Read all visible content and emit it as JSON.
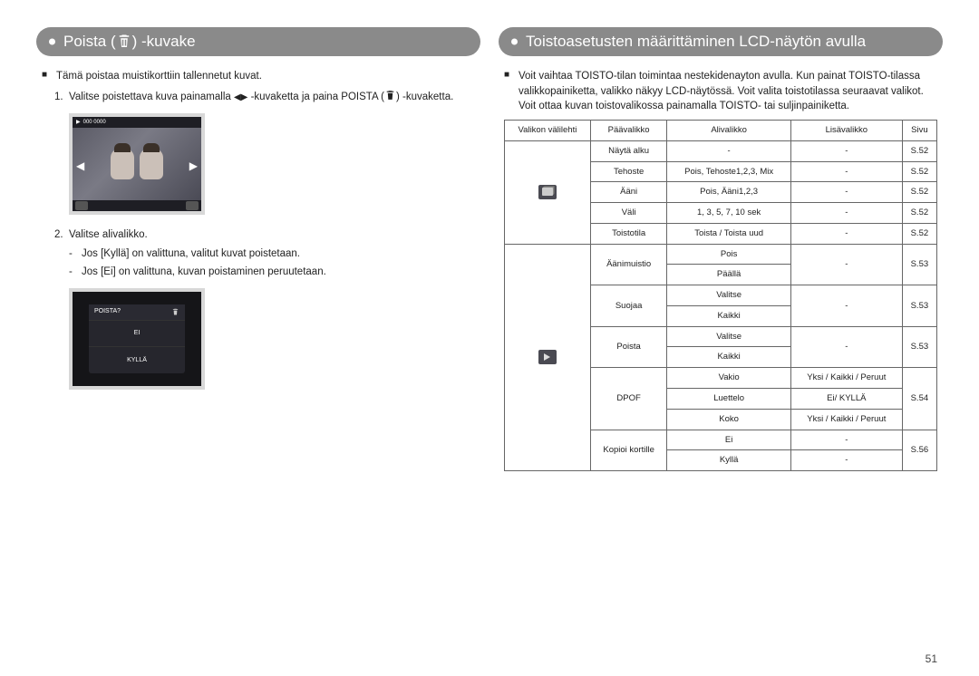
{
  "left": {
    "header_prefix": "Poista (",
    "header_suffix": ") -kuvake",
    "intro": "Tämä poistaa muistikorttiin tallennetut kuvat.",
    "step1a": "Valitse poistettava kuva painamalla ",
    "step1b": " -kuvaketta ja paina POISTA (",
    "step1c": ") -kuvaketta.",
    "cam1_top": "000 0000",
    "step2": "Valitse alivalikko.",
    "dash1": "Jos [Kyllä] on valittuna, valitut kuvat poistetaan.",
    "dash2": "Jos [Ei] on valittuna, kuvan poistaminen peruutetaan.",
    "cam2_title": "POISTA?",
    "cam2_opt1": "EI",
    "cam2_opt2": "KYLLÄ"
  },
  "right": {
    "header": "Toistoasetusten määrittäminen LCD-näytön avulla",
    "intro": "Voit vaihtaa TOISTO-tilan toimintaa nestekidenayton avulla. Kun painat TOISTO-tilassa valikkopainiketta, valikko näkyy LCD-näytössä. Voit valita toistotilassa seuraavat valikot. Voit ottaa kuvan toistovalikossa painamalla TOISTO- tai suljinpainiketta.",
    "th": {
      "tab": "Valikon välilehti",
      "main": "Päävalikko",
      "sub": "Alivalikko",
      "extra": "Lisävalikko",
      "page": "Sivu"
    },
    "rows": [
      {
        "main": "Näytä alku",
        "sub": "-",
        "extra": "-",
        "page": "S.52"
      },
      {
        "main": "Tehoste",
        "sub": "Pois, Tehoste1,2,3, Mix",
        "extra": "-",
        "page": "S.52"
      },
      {
        "main": "Ääni",
        "sub": "Pois, Ääni1,2,3",
        "extra": "-",
        "page": "S.52"
      },
      {
        "main": "Väli",
        "sub": "1, 3, 5, 7, 10 sek",
        "extra": "-",
        "page": "S.52"
      },
      {
        "main": "Toistotila",
        "sub": "Toista / Toista uud",
        "extra": "-",
        "page": "S.52"
      }
    ],
    "group2": [
      {
        "main": "Äänimuistio",
        "subs": [
          "Pois",
          "Päällä"
        ],
        "extra": "-",
        "page": "S.53"
      },
      {
        "main": "Suojaa",
        "subs": [
          "Valitse",
          "Kaikki"
        ],
        "extra": "-",
        "page": "S.53"
      },
      {
        "main": "Poista",
        "subs": [
          "Valitse",
          "Kaikki"
        ],
        "extra": "-",
        "page": "S.53"
      }
    ],
    "dpof": {
      "main": "DPOF",
      "rows": [
        {
          "sub": "Vakio",
          "extra": "Yksi / Kaikki / Peruut"
        },
        {
          "sub": "Luettelo",
          "extra": "Ei/ KYLLÄ"
        },
        {
          "sub": "Koko",
          "extra": "Yksi / Kaikki / Peruut"
        }
      ],
      "page": "S.54"
    },
    "kopio": {
      "main": "Kopioi kortille",
      "subs": [
        {
          "s": "Ei",
          "e": "-"
        },
        {
          "s": "Kyllä",
          "e": "-"
        }
      ],
      "page": "S.56"
    }
  },
  "pagenum": "51"
}
